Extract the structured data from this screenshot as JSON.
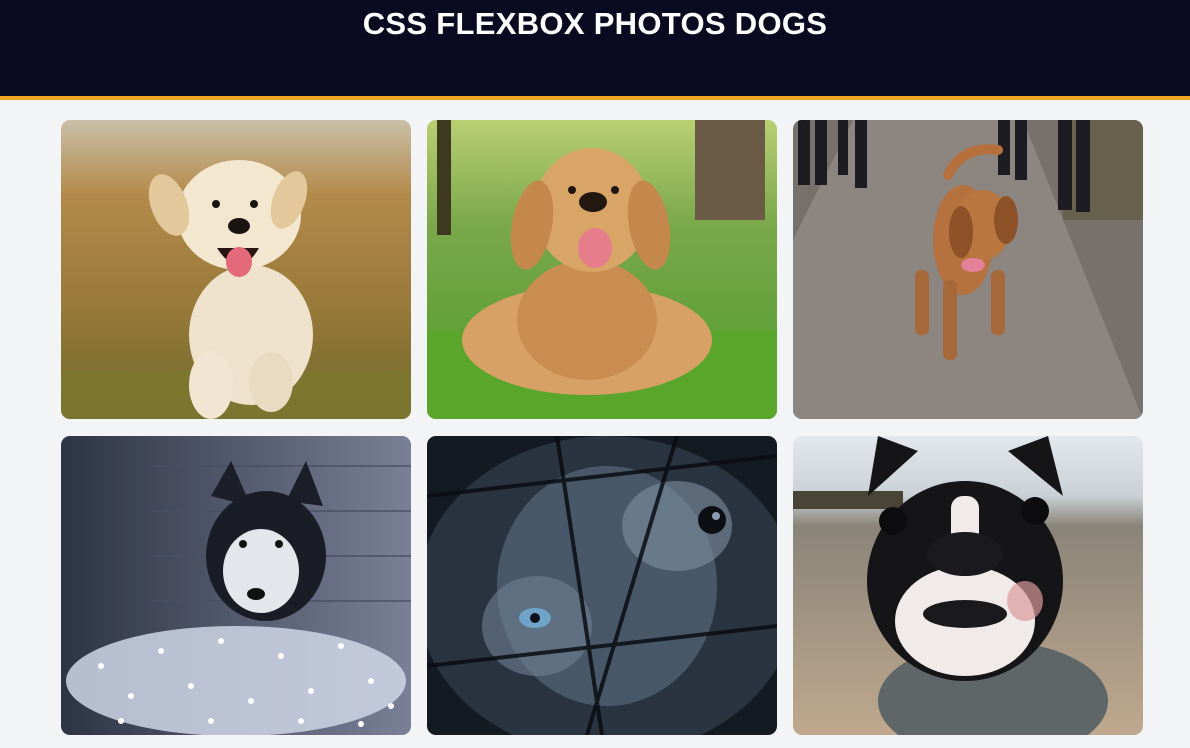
{
  "header": {
    "title": "CSS FLEXBOX PHOTOS DOGS",
    "background": "#090a1f",
    "accent_border": "#f5a524"
  },
  "gallery": {
    "photos": [
      {
        "subject": "golden retriever puppy running on grass"
      },
      {
        "subject": "golden retriever lying in green grass"
      },
      {
        "subject": "bloodhound walking on dirt path with people behind"
      },
      {
        "subject": "husky lying in string lights"
      },
      {
        "subject": "husky face close-up behind fence"
      },
      {
        "subject": "boston terrier in grey sweater on beach"
      }
    ]
  }
}
